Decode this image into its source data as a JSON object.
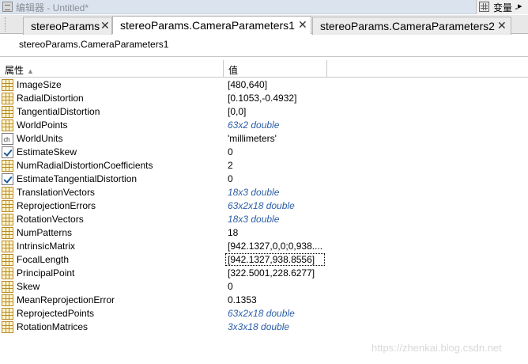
{
  "window": {
    "title": "编辑器 - Untitled*",
    "right_panel_label": "变量 -",
    "right_panel_arrow": "▸"
  },
  "tabs": [
    {
      "label": "stereoParams",
      "close": "✕",
      "active": false
    },
    {
      "label": "stereoParams.CameraParameters1",
      "close": "✕",
      "active": true
    },
    {
      "label": "stereoParams.CameraParameters2",
      "close": "✕",
      "active": false
    }
  ],
  "address": {
    "path": "stereoParams.CameraParameters1"
  },
  "table": {
    "columns": [
      {
        "label": "属性",
        "sort_indicator": "▲"
      },
      {
        "label": "值"
      }
    ],
    "rows": [
      {
        "icon": "grid-icon",
        "name": "ImageSize",
        "value": "[480,640]",
        "style": "plain"
      },
      {
        "icon": "grid-icon",
        "name": "RadialDistortion",
        "value": "[0.1053,-0.4932]",
        "style": "plain"
      },
      {
        "icon": "grid-icon",
        "name": "TangentialDistortion",
        "value": "[0,0]",
        "style": "plain"
      },
      {
        "icon": "grid-icon",
        "name": "WorldPoints",
        "value": "63x2 double",
        "style": "italic"
      },
      {
        "icon": "char-icon",
        "name": "WorldUnits",
        "value": "'millimeters'",
        "style": "plain"
      },
      {
        "icon": "check-icon",
        "name": "EstimateSkew",
        "value": "0",
        "style": "plain"
      },
      {
        "icon": "grid-icon",
        "name": "NumRadialDistortionCoefficients",
        "value": "2",
        "style": "plain"
      },
      {
        "icon": "check-icon",
        "name": "EstimateTangentialDistortion",
        "value": "0",
        "style": "plain"
      },
      {
        "icon": "grid-icon",
        "name": "TranslationVectors",
        "value": "18x3 double",
        "style": "italic"
      },
      {
        "icon": "grid-icon",
        "name": "ReprojectionErrors",
        "value": "63x2x18 double",
        "style": "italic"
      },
      {
        "icon": "grid-icon",
        "name": "RotationVectors",
        "value": "18x3 double",
        "style": "italic"
      },
      {
        "icon": "grid-icon",
        "name": "NumPatterns",
        "value": "18",
        "style": "plain"
      },
      {
        "icon": "grid-icon",
        "name": "IntrinsicMatrix",
        "value": "[942.1327,0,0;0,938....",
        "style": "plain"
      },
      {
        "icon": "grid-icon",
        "name": "FocalLength",
        "value": "[942.1327,938.8556]",
        "style": "focused"
      },
      {
        "icon": "grid-icon",
        "name": "PrincipalPoint",
        "value": "[322.5001,228.6277]",
        "style": "plain"
      },
      {
        "icon": "grid-icon",
        "name": "Skew",
        "value": "0",
        "style": "plain"
      },
      {
        "icon": "grid-icon",
        "name": "MeanReprojectionError",
        "value": "0.1353",
        "style": "plain"
      },
      {
        "icon": "grid-icon",
        "name": "ReprojectedPoints",
        "value": "63x2x18 double",
        "style": "italic"
      },
      {
        "icon": "grid-icon",
        "name": "RotationMatrices",
        "value": "3x3x18 double",
        "style": "italic"
      }
    ]
  },
  "watermark": "https://zhenkai.blog.csdn.net",
  "colors": {
    "italic_value": "#2b5ea7",
    "matrix_icon": "#b88a2a",
    "check_mark": "#1a5b9a"
  }
}
